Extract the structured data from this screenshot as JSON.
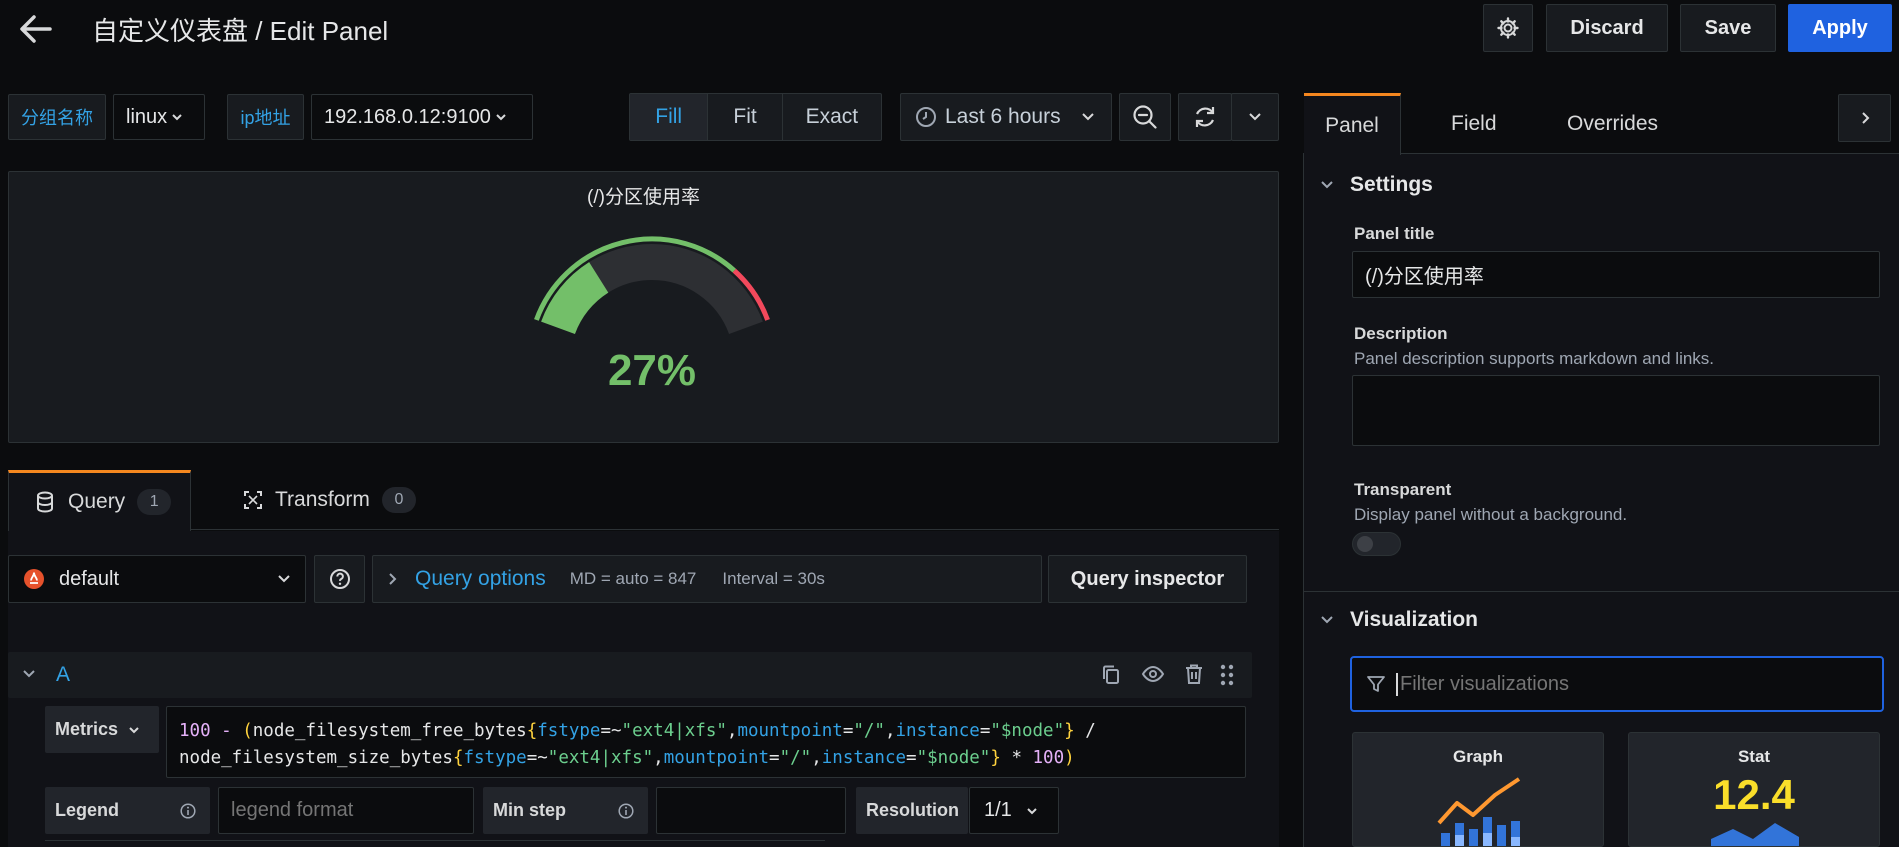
{
  "header": {
    "title": "自定义仪表盘 / Edit Panel",
    "discard": "Discard",
    "save": "Save",
    "apply": "Apply"
  },
  "variables": [
    {
      "label": "分组名称",
      "value": "linux"
    },
    {
      "label": "ip地址",
      "value": "192.168.0.12:9100"
    }
  ],
  "view_modes": [
    "Fill",
    "Fit",
    "Exact"
  ],
  "active_view_mode": "Fill",
  "time_range": "Last 6 hours",
  "panel": {
    "title": "(/)分区使用率",
    "value_text": "27%",
    "value": 27,
    "gauge_color": "#73bf69",
    "threshold_color": "#f2495c"
  },
  "query_tabs": [
    {
      "label": "Query",
      "count": "1"
    },
    {
      "label": "Transform",
      "count": "0"
    }
  ],
  "datasource": "default",
  "query_options": {
    "label": "Query options",
    "md": "MD = auto = 847",
    "interval": "Interval = 30s"
  },
  "query_inspector": "Query inspector",
  "query_a": {
    "ref": "A",
    "metrics_label": "Metrics",
    "line1": [
      {
        "t": "100 - ",
        "c": "k1"
      },
      {
        "t": "(",
        "c": "k2"
      },
      {
        "t": "node_filesystem_free_bytes",
        "c": ""
      },
      {
        "t": "{",
        "c": "k2"
      },
      {
        "t": "fstype",
        "c": "k4"
      },
      {
        "t": "=~",
        "c": ""
      },
      {
        "t": "\"ext4|xfs\"",
        "c": "k3"
      },
      {
        "t": ",",
        "c": ""
      },
      {
        "t": "mountpoint",
        "c": "k4"
      },
      {
        "t": "=",
        "c": ""
      },
      {
        "t": "\"/\"",
        "c": "k3"
      },
      {
        "t": ",",
        "c": ""
      },
      {
        "t": "instance",
        "c": "k4"
      },
      {
        "t": "=",
        "c": ""
      },
      {
        "t": "\"$node\"",
        "c": "k3"
      },
      {
        "t": "}",
        "c": "k2"
      },
      {
        "t": " /",
        "c": ""
      }
    ],
    "line2": [
      {
        "t": "node_filesystem_size_bytes",
        "c": ""
      },
      {
        "t": "{",
        "c": "k2"
      },
      {
        "t": "fstype",
        "c": "k4"
      },
      {
        "t": "=~",
        "c": ""
      },
      {
        "t": "\"ext4|xfs\"",
        "c": "k3"
      },
      {
        "t": ",",
        "c": ""
      },
      {
        "t": "mountpoint",
        "c": "k4"
      },
      {
        "t": "=",
        "c": ""
      },
      {
        "t": "\"/\"",
        "c": "k3"
      },
      {
        "t": ",",
        "c": ""
      },
      {
        "t": "instance",
        "c": "k4"
      },
      {
        "t": "=",
        "c": ""
      },
      {
        "t": "\"$node\"",
        "c": "k3"
      },
      {
        "t": "}",
        "c": "k2"
      },
      {
        "t": " * ",
        "c": ""
      },
      {
        "t": "100",
        "c": "k1"
      },
      {
        "t": ")",
        "c": "k2"
      }
    ],
    "legend_label": "Legend",
    "legend_placeholder": "legend format",
    "min_step_label": "Min step",
    "resolution_label": "Resolution",
    "resolution_value": "1/1"
  },
  "side_tabs": [
    "Panel",
    "Field",
    "Overrides"
  ],
  "settings": {
    "header": "Settings",
    "panel_title_label": "Panel title",
    "panel_title_value": "(/)分区使用率",
    "description_label": "Description",
    "description_help": "Panel description supports markdown and links.",
    "transparent_label": "Transparent",
    "transparent_help": "Display panel without a background."
  },
  "visualization": {
    "header": "Visualization",
    "filter_placeholder": "Filter visualizations",
    "cards": [
      {
        "name": "Graph"
      },
      {
        "name": "Stat",
        "sample": "12.4"
      }
    ]
  }
}
